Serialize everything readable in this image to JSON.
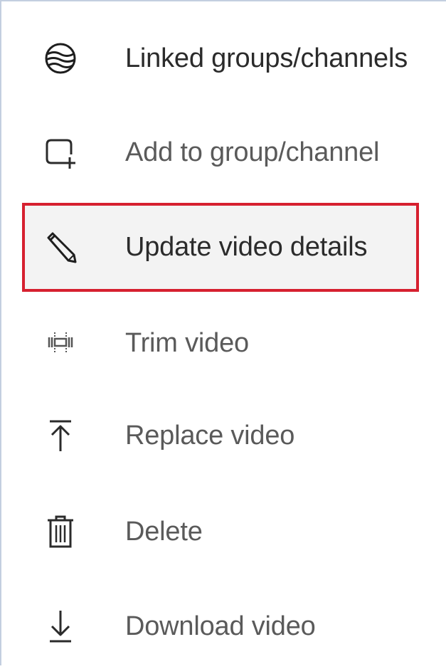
{
  "menu": {
    "items": [
      {
        "label": "Linked groups/channels",
        "icon": "linked-groups-icon"
      },
      {
        "label": "Add to group/channel",
        "icon": "add-to-group-icon"
      },
      {
        "label": "Update video details",
        "icon": "pencil-icon"
      },
      {
        "label": "Trim video",
        "icon": "trim-icon"
      },
      {
        "label": "Replace video",
        "icon": "upload-icon"
      },
      {
        "label": "Delete",
        "icon": "trash-icon"
      },
      {
        "label": "Download video",
        "icon": "download-icon"
      }
    ]
  },
  "colors": {
    "highlight_border": "#d6202f",
    "highlight_fill": "#f3f3f3",
    "label_primary": "#2b2b2b",
    "label_secondary": "#5a5a5a",
    "panel_border": "#c3cfe0"
  }
}
